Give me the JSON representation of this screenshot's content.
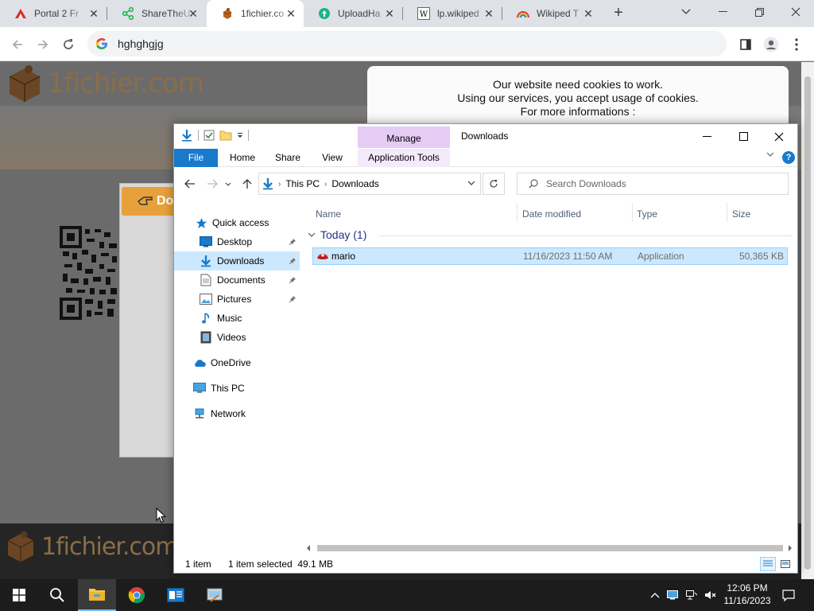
{
  "browser": {
    "tabs": [
      {
        "title": "Portal 2 Fr",
        "icon": "portal-icon",
        "active": false
      },
      {
        "title": "ShareTheU",
        "icon": "share-icon",
        "active": false
      },
      {
        "title": "1fichier.co",
        "icon": "fichier-icon",
        "active": true
      },
      {
        "title": "UploadHa",
        "icon": "upload-icon",
        "active": false
      },
      {
        "title": "lp.wikiped",
        "icon": "wikipedia-icon",
        "active": false
      },
      {
        "title": "Wikiped T",
        "icon": "rainbow-icon",
        "active": false
      }
    ],
    "close_glyph": "✕",
    "new_tab_glyph": "+",
    "omnibox_value": "hghghgjg"
  },
  "website": {
    "logo_text": "1fichier.com",
    "download_button_label": "Do",
    "cookie_lines": [
      "Our website need cookies to work.",
      "Using our services, you accept usage of cookies.",
      "For more informations :"
    ],
    "footer_logo_text": "1fichier.com"
  },
  "explorer": {
    "window_title": "Downloads",
    "contextual_tab_label": "Manage",
    "ribbon_tabs": [
      "File",
      "Home",
      "Share",
      "View",
      "Application Tools"
    ],
    "address_crumbs": [
      "This PC",
      "Downloads"
    ],
    "search_placeholder": "Search Downloads",
    "nav_items": [
      {
        "label": "Quick access",
        "icon": "star-icon",
        "selected": false,
        "pinned": false
      },
      {
        "label": "Desktop",
        "icon": "desktop-icon",
        "selected": false,
        "pinned": true
      },
      {
        "label": "Downloads",
        "icon": "download-icon",
        "selected": true,
        "pinned": true
      },
      {
        "label": "Documents",
        "icon": "documents-icon",
        "selected": false,
        "pinned": true
      },
      {
        "label": "Pictures",
        "icon": "pictures-icon",
        "selected": false,
        "pinned": true
      },
      {
        "label": "Music",
        "icon": "music-icon",
        "selected": false,
        "pinned": false
      },
      {
        "label": "Videos",
        "icon": "videos-icon",
        "selected": false,
        "pinned": false
      },
      {
        "label": "OneDrive",
        "icon": "cloud-icon",
        "selected": false,
        "pinned": false
      },
      {
        "label": "This PC",
        "icon": "computer-icon",
        "selected": false,
        "pinned": false
      },
      {
        "label": "Network",
        "icon": "network-icon",
        "selected": false,
        "pinned": false
      }
    ],
    "columns": [
      "Name",
      "Date modified",
      "Type",
      "Size"
    ],
    "group_label": "Today (1)",
    "files": [
      {
        "name": "mario",
        "date_modified": "11/16/2023 11:50 AM",
        "type": "Application",
        "size": "50,365 KB",
        "selected": true
      }
    ],
    "status": {
      "item_count": "1 item",
      "selection": "1 item selected  49.1 MB"
    }
  },
  "taskbar": {
    "apps": [
      {
        "name": "start",
        "icon": "windows-icon"
      },
      {
        "name": "search",
        "icon": "search-icon"
      },
      {
        "name": "file-explorer",
        "icon": "folder-icon",
        "active": true
      },
      {
        "name": "chrome",
        "icon": "chrome-icon"
      },
      {
        "name": "app-1",
        "icon": "app-window-icon"
      },
      {
        "name": "app-2",
        "icon": "app-tool-icon"
      }
    ],
    "time": "12:06 PM",
    "date": "11/16/2023"
  },
  "colors": {
    "accent": "#1979ca",
    "selection": "#cce8ff",
    "manage_tab": "#e6ccf5",
    "site_brown": "#8a6e48",
    "download_orange": "#e8a13a"
  }
}
